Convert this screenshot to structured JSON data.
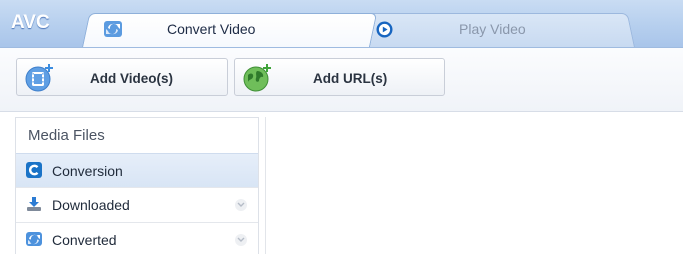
{
  "app": {
    "logo": "AVC"
  },
  "tabs": [
    {
      "label": "Convert Video",
      "icon": "convert-icon",
      "active": true
    },
    {
      "label": "Play Video",
      "icon": "play-icon",
      "active": false
    }
  ],
  "toolbar": {
    "add_video_label": "Add Video(s)",
    "add_url_label": "Add URL(s)"
  },
  "sidebar": {
    "header": "Media Files",
    "items": [
      {
        "label": "Conversion",
        "icon": "conversion-icon",
        "active": true
      },
      {
        "label": "Downloaded",
        "icon": "download-icon",
        "active": false
      },
      {
        "label": "Converted",
        "icon": "converted-icon",
        "active": false
      }
    ]
  },
  "colors": {
    "tabbar": "#b6cfee",
    "accent": "#1a73c7",
    "active_item": "#d8e5f5"
  }
}
